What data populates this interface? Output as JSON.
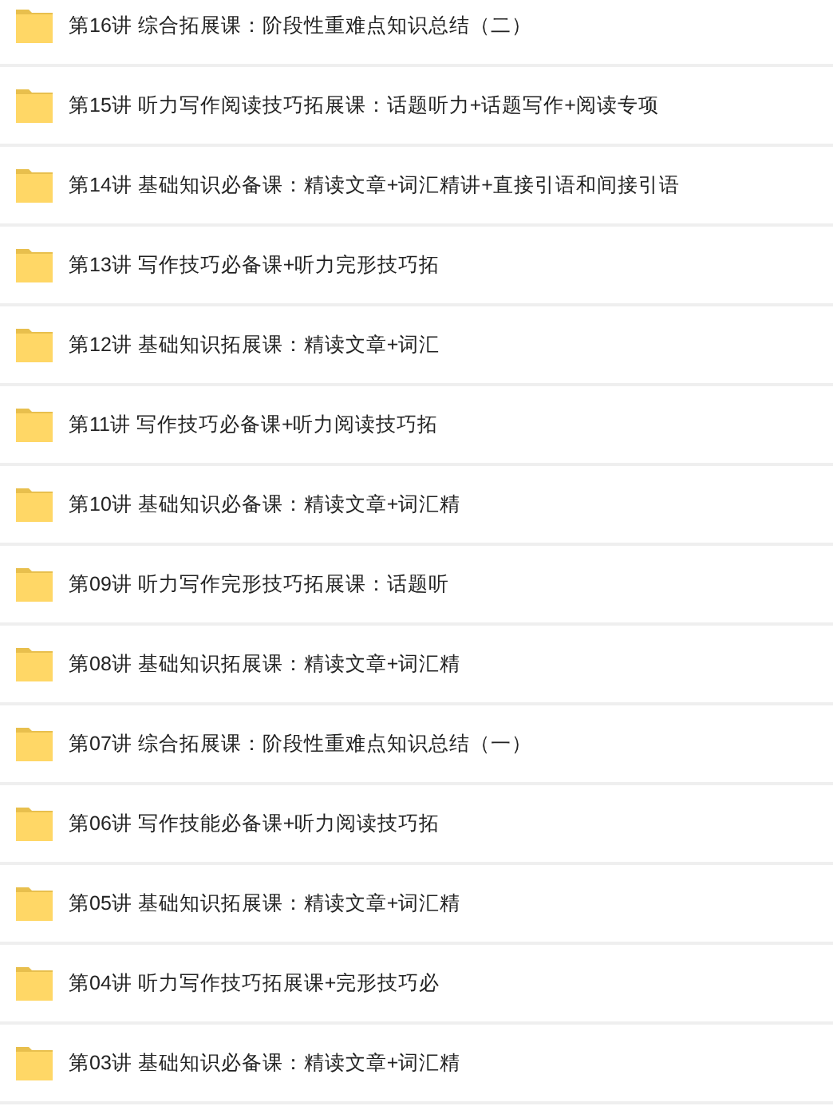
{
  "folders": [
    {
      "name": "第16讲 综合拓展课：阶段性重难点知识总结（二）"
    },
    {
      "name": "第15讲 听力写作阅读技巧拓展课：话题听力+话题写作+阅读专项"
    },
    {
      "name": "第14讲 基础知识必备课：精读文章+词汇精讲+直接引语和间接引语"
    },
    {
      "name": "第13讲 写作技巧必备课+听力完形技巧拓"
    },
    {
      "name": "第12讲 基础知识拓展课：精读文章+词汇"
    },
    {
      "name": "第11讲 写作技巧必备课+听力阅读技巧拓"
    },
    {
      "name": "第10讲 基础知识必备课：精读文章+词汇精"
    },
    {
      "name": "第09讲 听力写作完形技巧拓展课：话题听"
    },
    {
      "name": "第08讲 基础知识拓展课：精读文章+词汇精"
    },
    {
      "name": "第07讲 综合拓展课：阶段性重难点知识总结（一）"
    },
    {
      "name": "第06讲 写作技能必备课+听力阅读技巧拓"
    },
    {
      "name": "第05讲 基础知识拓展课：精读文章+词汇精"
    },
    {
      "name": "第04讲 听力写作技巧拓展课+完形技巧必"
    },
    {
      "name": "第03讲 基础知识必备课：精读文章+词汇精"
    }
  ]
}
